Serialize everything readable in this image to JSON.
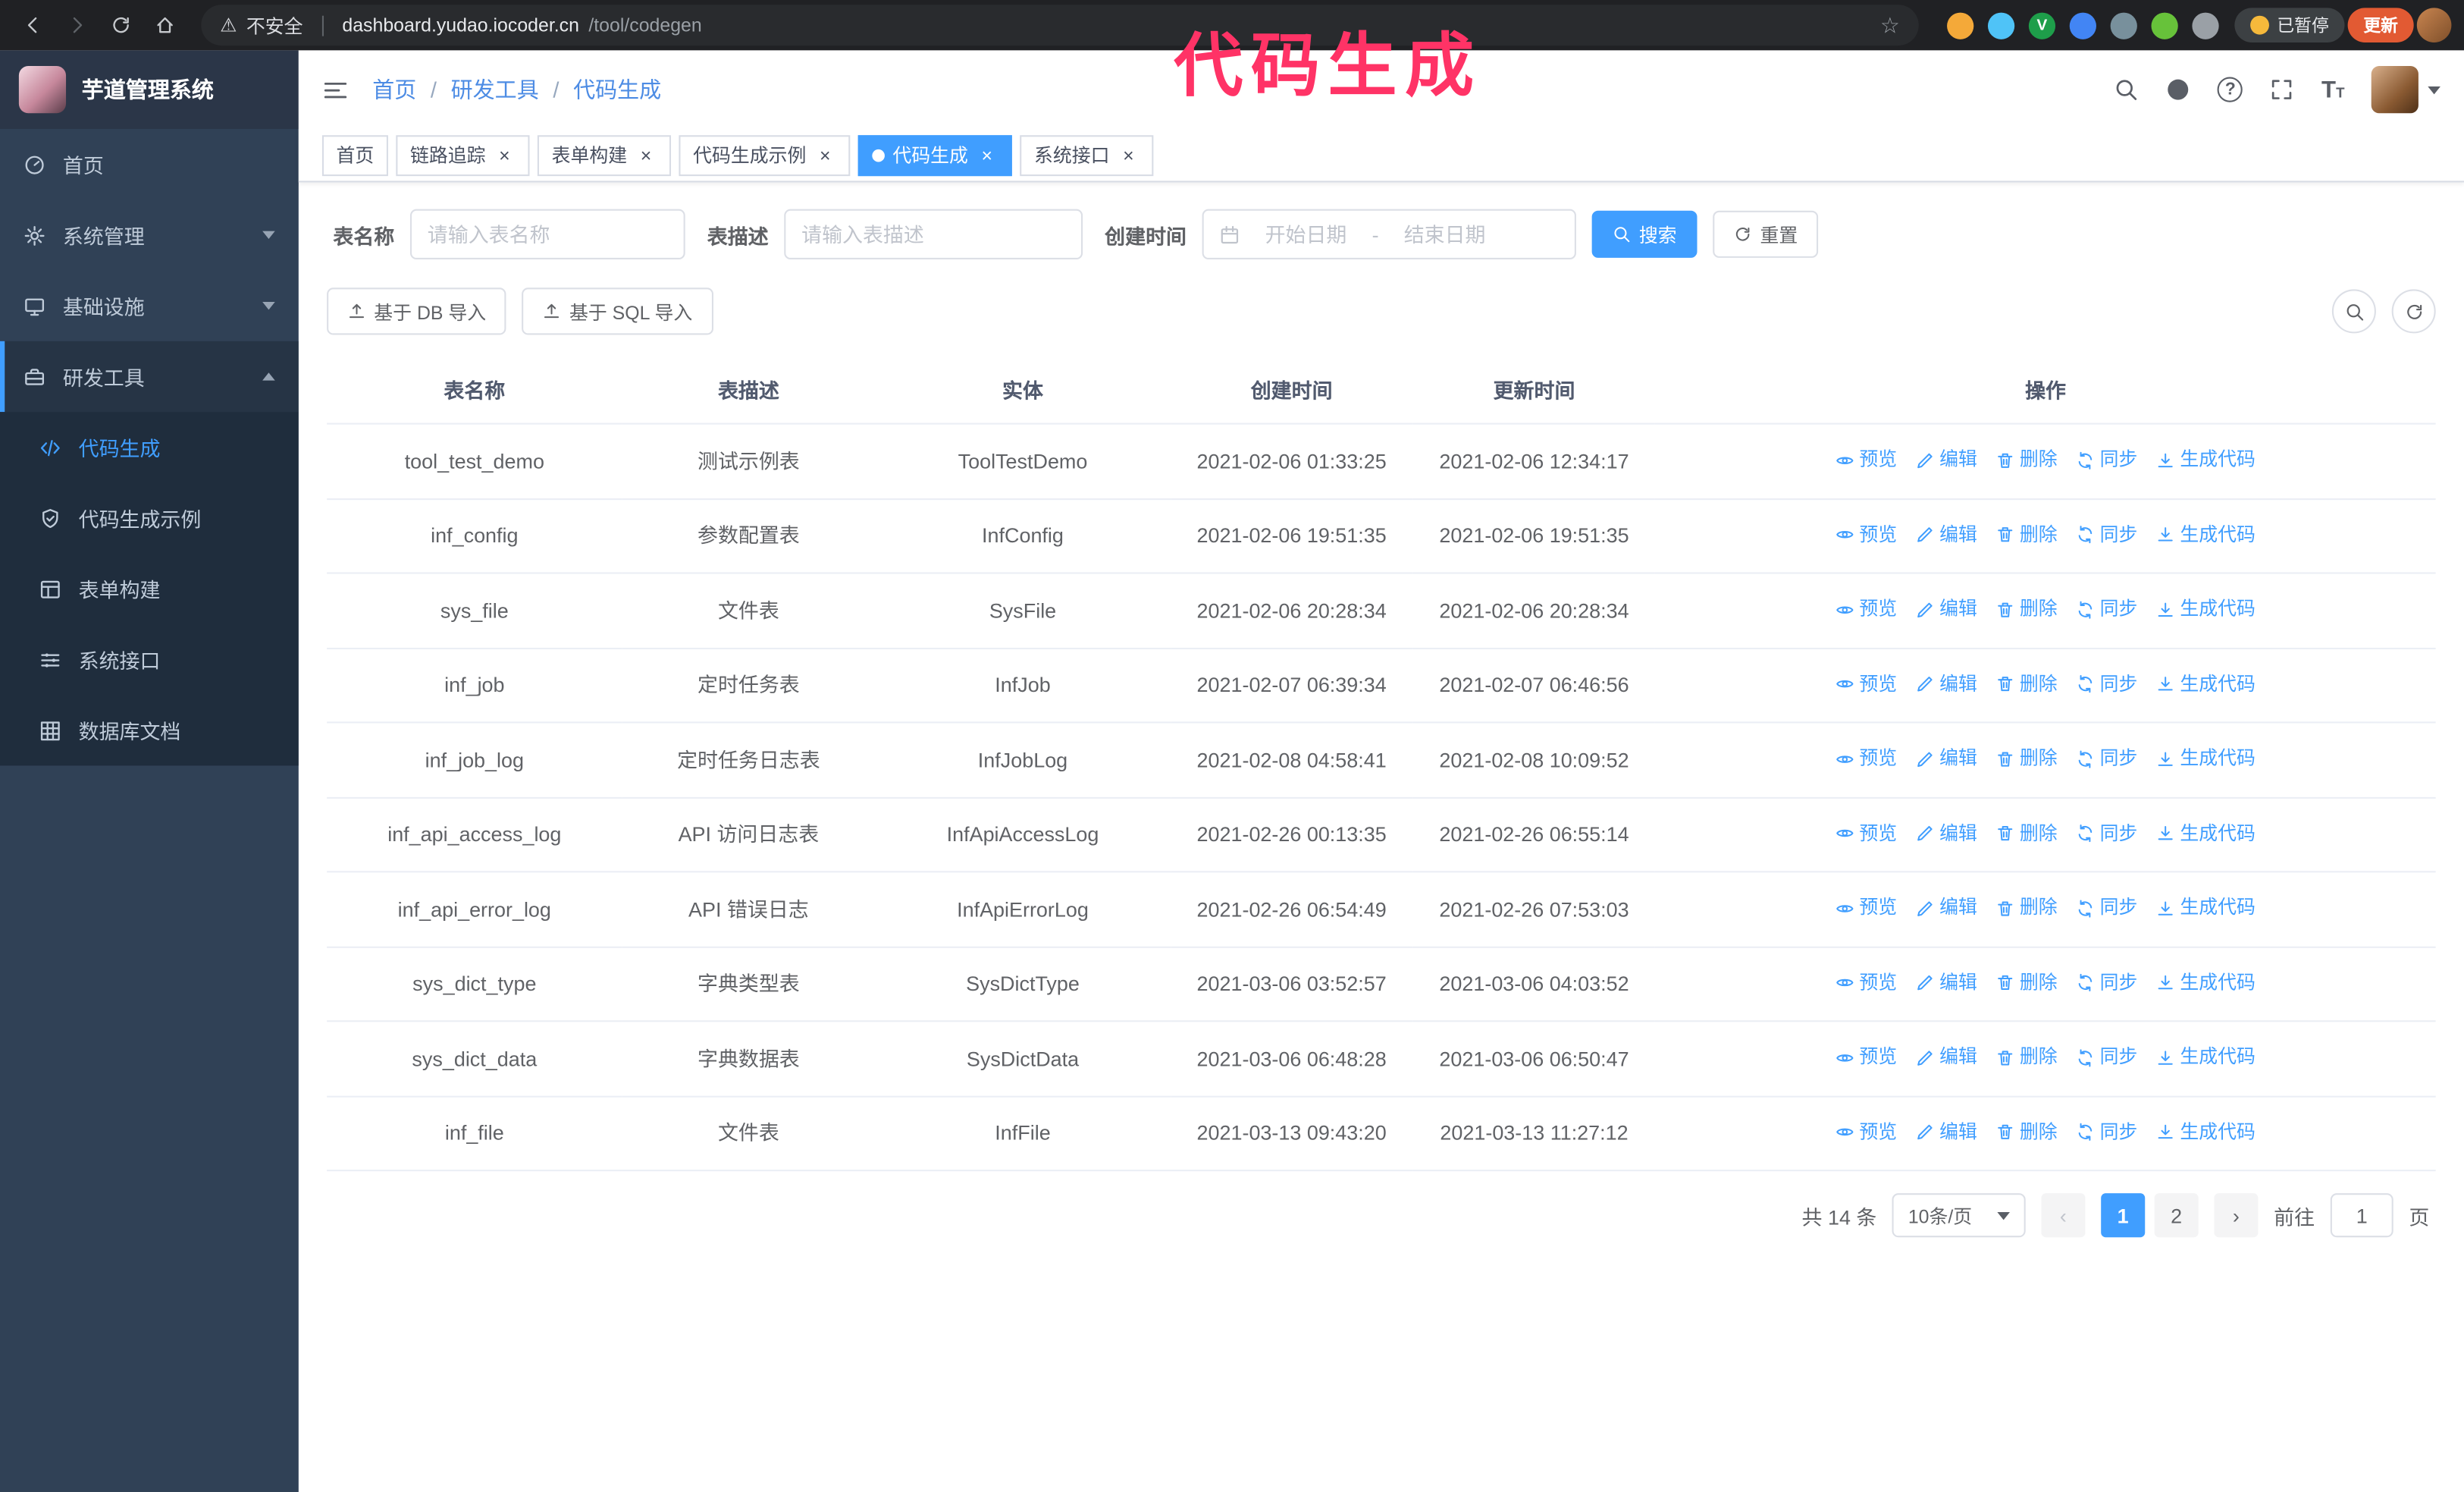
{
  "browser": {
    "security_label": "不安全",
    "url_host": "dashboard.yudao.iocoder.cn",
    "url_path": "/tool/codegen",
    "paused_badge": "已暂停",
    "update_button": "更新",
    "extensions": [
      {
        "color": "#f4a939",
        "letter": ""
      },
      {
        "color": "#4fc3f7",
        "letter": ""
      },
      {
        "color": "#1e9e4a",
        "letter": "V"
      },
      {
        "color": "#4285f4",
        "letter": ""
      },
      {
        "color": "#78909c",
        "letter": ""
      },
      {
        "color": "#67c23a",
        "letter": ""
      },
      {
        "color": "#9aa0a6",
        "letter": ""
      }
    ]
  },
  "annotation": {
    "text": "代码生成",
    "color": "#ff3366"
  },
  "sidebar": {
    "logo_title": "芋道管理系统",
    "items": [
      {
        "id": "home",
        "label": "首页",
        "icon": "dashboard-icon",
        "expandable": false,
        "expanded": false
      },
      {
        "id": "system",
        "label": "系统管理",
        "icon": "gear-icon",
        "expandable": true,
        "expanded": false
      },
      {
        "id": "infra",
        "label": "基础设施",
        "icon": "infra-icon",
        "expandable": true,
        "expanded": false
      },
      {
        "id": "devtools",
        "label": "研发工具",
        "icon": "tools-icon",
        "expandable": true,
        "expanded": true
      }
    ],
    "sub_items": [
      {
        "id": "codegen",
        "label": "代码生成",
        "icon": "code-icon",
        "active": true
      },
      {
        "id": "codegen-example",
        "label": "代码生成示例",
        "icon": "example-icon",
        "active": false
      },
      {
        "id": "form-builder",
        "label": "表单构建",
        "icon": "form-icon",
        "active": false
      },
      {
        "id": "api",
        "label": "系统接口",
        "icon": "api-icon",
        "active": false
      },
      {
        "id": "db-doc",
        "label": "数据库文档",
        "icon": "db-icon",
        "active": false
      }
    ]
  },
  "header": {
    "breadcrumb": [
      "首页",
      "研发工具",
      "代码生成"
    ]
  },
  "tags": [
    {
      "label": "首页",
      "closable": false,
      "active": false
    },
    {
      "label": "链路追踪",
      "closable": true,
      "active": false
    },
    {
      "label": "表单构建",
      "closable": true,
      "active": false
    },
    {
      "label": "代码生成示例",
      "closable": true,
      "active": false
    },
    {
      "label": "代码生成",
      "closable": true,
      "active": true
    },
    {
      "label": "系统接口",
      "closable": true,
      "active": false
    }
  ],
  "filters": {
    "table_name_label": "表名称",
    "table_name_placeholder": "请输入表名称",
    "table_desc_label": "表描述",
    "table_desc_placeholder": "请输入表描述",
    "create_time_label": "创建时间",
    "date_start_placeholder": "开始日期",
    "date_separator": "-",
    "date_end_placeholder": "结束日期",
    "search_button": "搜索",
    "reset_button": "重置"
  },
  "toolbar": {
    "import_db_button": "基于 DB 导入",
    "import_sql_button": "基于 SQL 导入"
  },
  "table": {
    "headers": [
      "表名称",
      "表描述",
      "实体",
      "创建时间",
      "更新时间",
      "操作"
    ],
    "action_labels": [
      "预览",
      "编辑",
      "删除",
      "同步",
      "生成代码"
    ],
    "rows": [
      {
        "name": "tool_test_demo",
        "desc": "测试示例表",
        "entity": "ToolTestDemo",
        "create_time": "2021-02-06 01:33:25",
        "update_time": "2021-02-06 12:34:17"
      },
      {
        "name": "inf_config",
        "desc": "参数配置表",
        "entity": "InfConfig",
        "create_time": "2021-02-06 19:51:35",
        "update_time": "2021-02-06 19:51:35"
      },
      {
        "name": "sys_file",
        "desc": "文件表",
        "entity": "SysFile",
        "create_time": "2021-02-06 20:28:34",
        "update_time": "2021-02-06 20:28:34"
      },
      {
        "name": "inf_job",
        "desc": "定时任务表",
        "entity": "InfJob",
        "create_time": "2021-02-07 06:39:34",
        "update_time": "2021-02-07 06:46:56"
      },
      {
        "name": "inf_job_log",
        "desc": "定时任务日志表",
        "entity": "InfJobLog",
        "create_time": "2021-02-08 04:58:41",
        "update_time": "2021-02-08 10:09:52"
      },
      {
        "name": "inf_api_access_log",
        "desc": "API 访问日志表",
        "entity": "InfApiAccessLog",
        "create_time": "2021-02-26 00:13:35",
        "update_time": "2021-02-26 06:55:14"
      },
      {
        "name": "inf_api_error_log",
        "desc": "API 错误日志",
        "entity": "InfApiErrorLog",
        "create_time": "2021-02-26 06:54:49",
        "update_time": "2021-02-26 07:53:03"
      },
      {
        "name": "sys_dict_type",
        "desc": "字典类型表",
        "entity": "SysDictType",
        "create_time": "2021-03-06 03:52:57",
        "update_time": "2021-03-06 04:03:52"
      },
      {
        "name": "sys_dict_data",
        "desc": "字典数据表",
        "entity": "SysDictData",
        "create_time": "2021-03-06 06:48:28",
        "update_time": "2021-03-06 06:50:47"
      },
      {
        "name": "inf_file",
        "desc": "文件表",
        "entity": "InfFile",
        "create_time": "2021-03-13 09:43:20",
        "update_time": "2021-03-13 11:27:12"
      }
    ]
  },
  "pagination": {
    "total": "共 14 条",
    "page_size": "10条/页",
    "pages": [
      "1",
      "2"
    ],
    "current_page": "1",
    "goto_label": "前往",
    "goto_value": "1",
    "page_suffix": "页"
  },
  "colors": {
    "accent": "#409eff",
    "sidebar_bg": "#304156",
    "submenu_bg": "#1f2d3d",
    "chrome_bg": "#202124"
  }
}
